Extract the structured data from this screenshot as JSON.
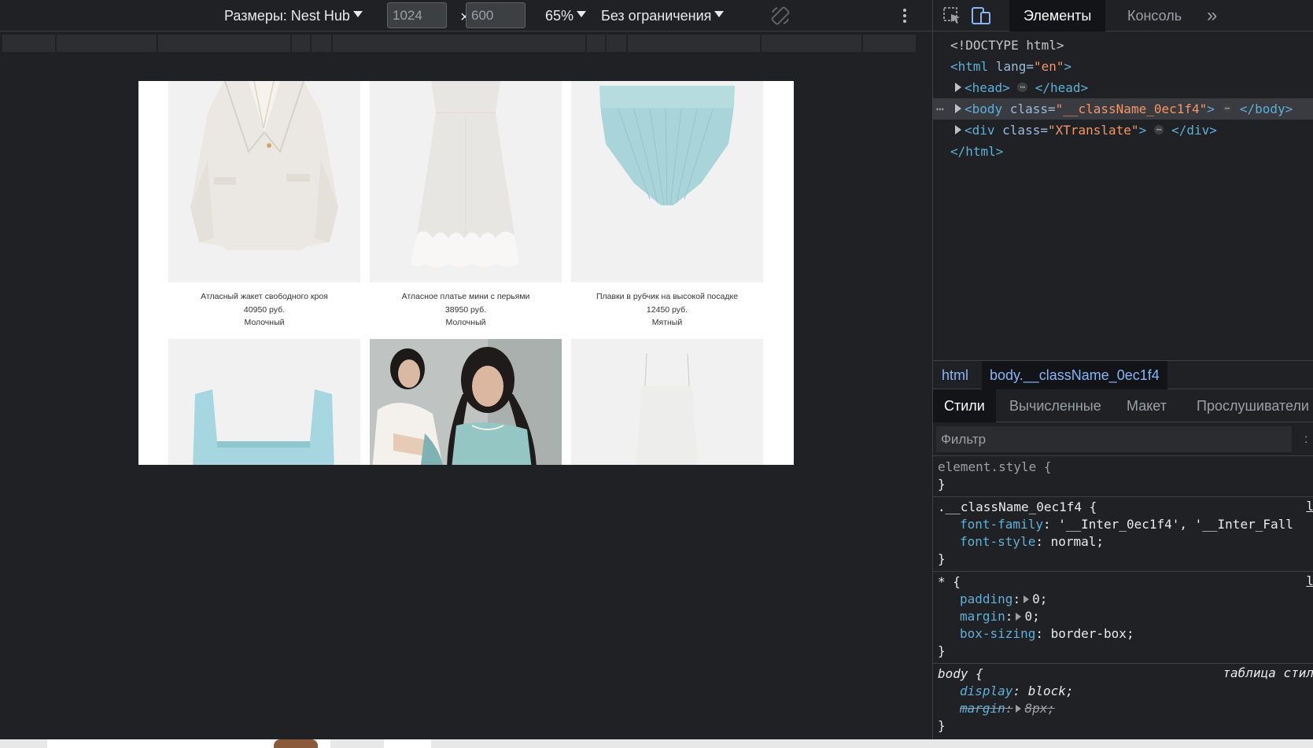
{
  "device_toolbar": {
    "device_label": "Размеры: Nest Hub",
    "width": "1024",
    "height": "600",
    "times": "×",
    "zoom": "65%",
    "throttle": "Без ограничения"
  },
  "emulated_page": {
    "products": [
      {
        "name": "Атласный жакет свободного кроя",
        "price": "40950 руб.",
        "color": "Молочный"
      },
      {
        "name": "Атласное платье мини с перьями",
        "price": "38950 руб.",
        "color": "Молочный"
      },
      {
        "name": "Плавки в рубчик на высокой посадке",
        "price": "12450 руб.",
        "color": "Мятный"
      }
    ]
  },
  "devtools": {
    "tabs": {
      "elements": "Элементы",
      "console": "Консоль",
      "more": "»"
    },
    "dom": {
      "doctype": "<!DOCTYPE html>",
      "html_open_tag": "<html",
      "html_lang_attr": " lang=",
      "html_lang_val": "\"en\"",
      "html_close_bracket": ">",
      "head_open": "<head>",
      "head_close": "</head>",
      "body_open": "<body",
      "body_class_attr": " class=",
      "body_class_val": "\"__className_0ec1f4\"",
      "body_gt": ">",
      "body_close": "</body>",
      "div_open": "<div",
      "div_class_attr": " class=",
      "div_class_val": "\"XTranslate\"",
      "div_gt": ">",
      "div_close": "</div>",
      "html_close": "</html>",
      "ellipsis": "⋯",
      "selected_dots": "⋯"
    },
    "breadcrumbs": [
      "html",
      "body.__className_0ec1f4"
    ],
    "sub_tabs": [
      "Стили",
      "Вычисленные",
      "Макет",
      "Прослушиватели"
    ],
    "filter_placeholder": "Фильтр",
    "filter_colon": ":",
    "styles": {
      "element_style": "element.style {",
      "close_brace": "}",
      "class_selector": ".__className_0ec1f4 {",
      "class_src": "l",
      "font_family_name": "font-family",
      "font_family_val": "'__Inter_0ec1f4', '__Inter_Fall",
      "font_style_name": "font-style",
      "font_style_val": "normal;",
      "star_selector": "* {",
      "star_src": "l",
      "padding_name": "padding",
      "padding_val": "0;",
      "margin_name": "margin",
      "margin_val": "0;",
      "boxsizing_name": "box-sizing",
      "boxsizing_val": "border-box;",
      "body_selector": "body {",
      "body_src": "таблица стил",
      "display_name": "display",
      "display_val": "block;",
      "body_margin_name": "margin",
      "body_margin_val": "8px;",
      "colon": ":"
    }
  }
}
